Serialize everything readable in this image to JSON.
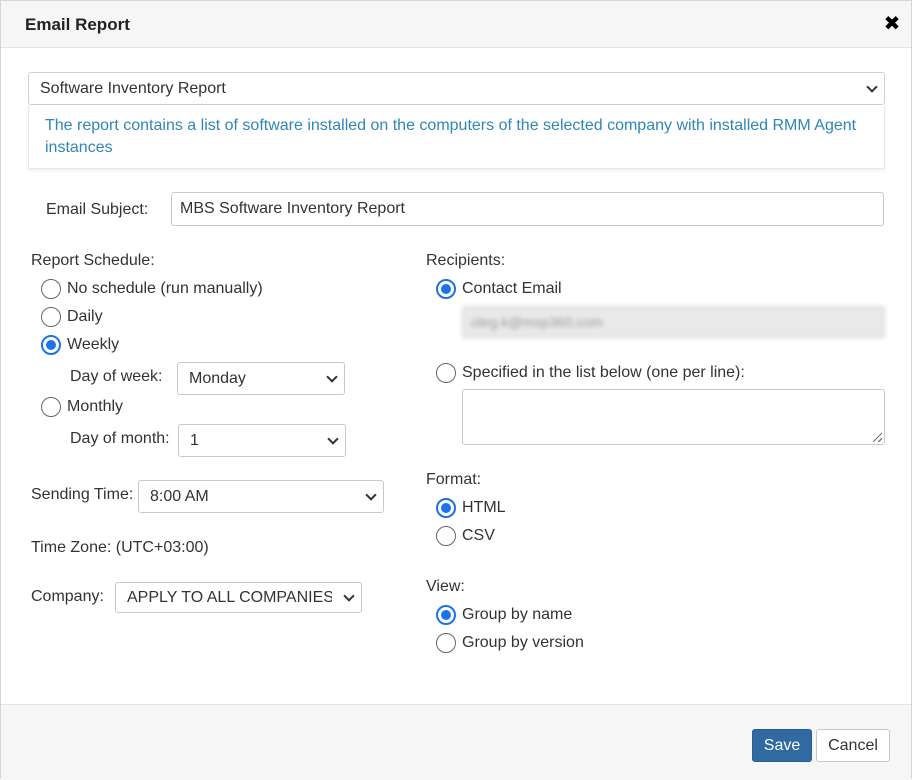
{
  "dialog": {
    "title": "Email Report",
    "close_icon": "close-icon"
  },
  "report": {
    "selected": "Software Inventory Report",
    "description": "The report contains a list of software installed on the computers of the selected company with installed RMM Agent instances"
  },
  "subject": {
    "label": "Email Subject:",
    "value": "MBS Software Inventory Report"
  },
  "schedule": {
    "label": "Report Schedule:",
    "options": [
      {
        "label": "No schedule (run manually)",
        "checked": false
      },
      {
        "label": "Daily",
        "checked": false
      },
      {
        "label": "Weekly",
        "checked": true
      },
      {
        "label": "Monthly",
        "checked": false
      }
    ],
    "day_of_week_label": "Day of week:",
    "day_of_week_value": "Monday",
    "day_of_month_label": "Day of month:",
    "day_of_month_value": "1"
  },
  "sending_time": {
    "label": "Sending Time:",
    "value": "8:00 AM"
  },
  "time_zone": "Time Zone: (UTC+03:00)",
  "company": {
    "label": "Company:",
    "value": "APPLY TO ALL COMPANIES (ALL)"
  },
  "recipients": {
    "label": "Recipients:",
    "contact_email_label": "Contact Email",
    "contact_email_checked": true,
    "contact_email_value": "oleg.k@msp360.com",
    "specified_label": "Specified in the list below (one per line):",
    "specified_checked": false,
    "specified_value": ""
  },
  "format": {
    "label": "Format:",
    "options": [
      {
        "label": "HTML",
        "checked": true
      },
      {
        "label": "CSV",
        "checked": false
      }
    ]
  },
  "view": {
    "label": "View:",
    "options": [
      {
        "label": "Group by name",
        "checked": true
      },
      {
        "label": "Group by version",
        "checked": false
      }
    ]
  },
  "footer": {
    "save_label": "Save",
    "cancel_label": "Cancel"
  },
  "colors": {
    "accent": "#1a73e8",
    "description_text": "#2f86b7",
    "save_button": "#2f6aa3"
  }
}
